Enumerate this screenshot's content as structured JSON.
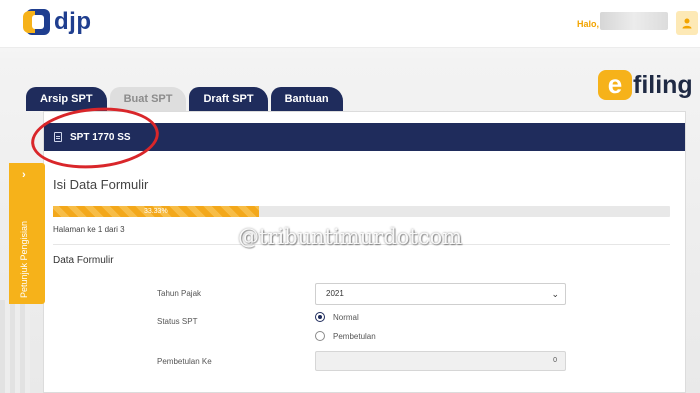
{
  "header": {
    "logo_text": "djp",
    "greeting": "Halo,",
    "user_icon": "user-icon"
  },
  "brand": {
    "efiling_mark": "e",
    "efiling_text": "filing"
  },
  "tabs": [
    {
      "label": "Arsip SPT",
      "active": true
    },
    {
      "label": "Buat SPT",
      "active": false
    },
    {
      "label": "Draft SPT",
      "active": true
    },
    {
      "label": "Bantuan",
      "active": true
    }
  ],
  "card": {
    "header_title": "SPT 1770 SS",
    "section_title": "Isi Data Formulir",
    "progress_label": "33.33%",
    "progress_value": 0.3333,
    "page_info": "Halaman ke 1 dari 3",
    "subsection": "Data Formulir"
  },
  "form": {
    "tahun_label": "Tahun Pajak",
    "tahun_value": "2021",
    "status_label": "Status SPT",
    "status_options": [
      "Normal",
      "Pembetulan"
    ],
    "status_selected": "Normal",
    "pembetulan_label": "Pembetulan Ke",
    "pembetulan_value": "0"
  },
  "side_panel": {
    "label": "Petunjuk Pengisian",
    "chevron": "›"
  },
  "watermark": "@tribuntimurdotcom",
  "colors": {
    "navy": "#1f2c5c",
    "accent": "#f6b21a",
    "annotation_red": "#d9262a"
  }
}
